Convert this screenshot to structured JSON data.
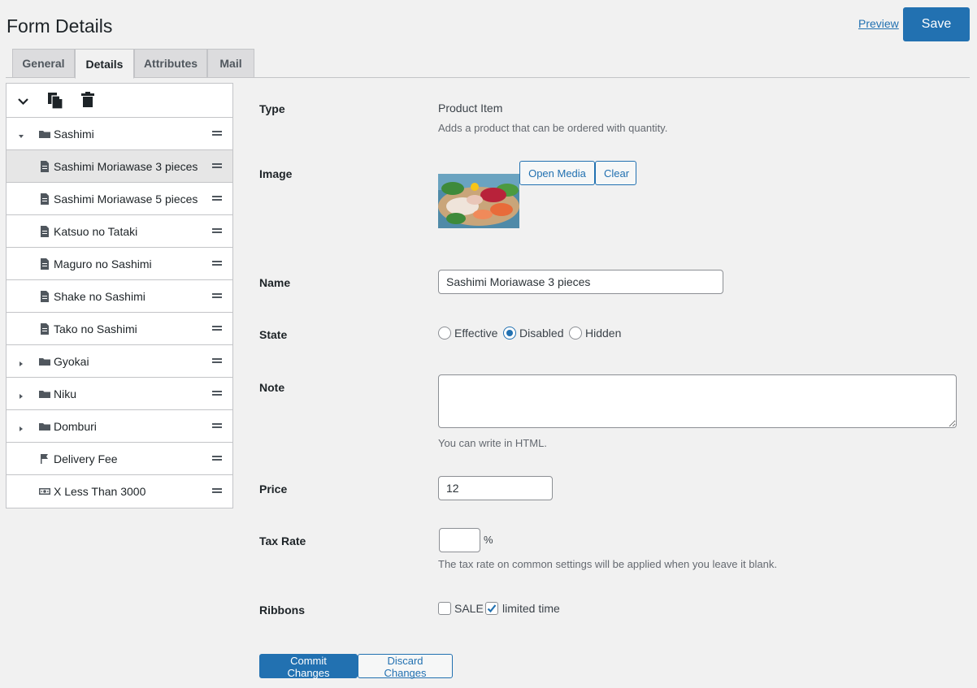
{
  "header": {
    "title": "Form Details",
    "preview_label": "Preview",
    "save_label": "Save"
  },
  "tabs": [
    {
      "label": "General",
      "active": false
    },
    {
      "label": "Details",
      "active": true
    },
    {
      "label": "Attributes",
      "active": false
    },
    {
      "label": "Mail",
      "active": false
    }
  ],
  "tree": {
    "toolbar": [
      "chevron-down-icon",
      "copy-icon",
      "trash-icon"
    ],
    "items": [
      {
        "label": "Sashimi",
        "icon": "folder-icon",
        "caret": "open",
        "indent": 0
      },
      {
        "label": "Sashimi Moriawase 3 pieces",
        "icon": "document-icon",
        "indent": 1,
        "selected": true
      },
      {
        "label": "Sashimi Moriawase 5 pieces",
        "icon": "document-icon",
        "indent": 1
      },
      {
        "label": "Katsuo no Tataki",
        "icon": "document-icon",
        "indent": 1
      },
      {
        "label": "Maguro no Sashimi",
        "icon": "document-icon",
        "indent": 1
      },
      {
        "label": "Shake no Sashimi",
        "icon": "document-icon",
        "indent": 1
      },
      {
        "label": "Tako no Sashimi",
        "icon": "document-icon",
        "indent": 1
      },
      {
        "label": "Gyokai",
        "icon": "folder-icon",
        "caret": "closed",
        "indent": 0
      },
      {
        "label": "Niku",
        "icon": "folder-icon",
        "caret": "closed",
        "indent": 0
      },
      {
        "label": "Domburi",
        "icon": "folder-icon",
        "caret": "closed",
        "indent": 0
      },
      {
        "label": "Delivery Fee",
        "icon": "flag-icon",
        "indent": 0
      },
      {
        "label": "X Less Than 3000",
        "icon": "money-icon",
        "indent": 0
      }
    ]
  },
  "form": {
    "type": {
      "label": "Type",
      "value": "Product Item",
      "description": "Adds a product that can be ordered with quantity."
    },
    "image": {
      "label": "Image",
      "open_media_label": "Open Media",
      "clear_label": "Clear"
    },
    "name": {
      "label": "Name",
      "value": "Sashimi Moriawase 3 pieces"
    },
    "state": {
      "label": "State",
      "options": [
        {
          "label": "Effective",
          "checked": false
        },
        {
          "label": "Disabled",
          "checked": true
        },
        {
          "label": "Hidden",
          "checked": false
        }
      ]
    },
    "note": {
      "label": "Note",
      "value": "",
      "help": "You can write in HTML."
    },
    "price": {
      "label": "Price",
      "value": "12"
    },
    "tax_rate": {
      "label": "Tax Rate",
      "value": "",
      "unit": "%",
      "help": "The tax rate on common settings will be applied when you leave it blank."
    },
    "ribbons": {
      "label": "Ribbons",
      "options": [
        {
          "label": "SALE",
          "checked": false
        },
        {
          "label": "limited time",
          "checked": true
        }
      ]
    }
  },
  "actions": {
    "commit_label": "Commit Changes",
    "discard_label": "Discard Changes"
  },
  "colors": {
    "accent": "#2271b1",
    "background": "#f1f1f1",
    "border": "#c3c4c7"
  }
}
